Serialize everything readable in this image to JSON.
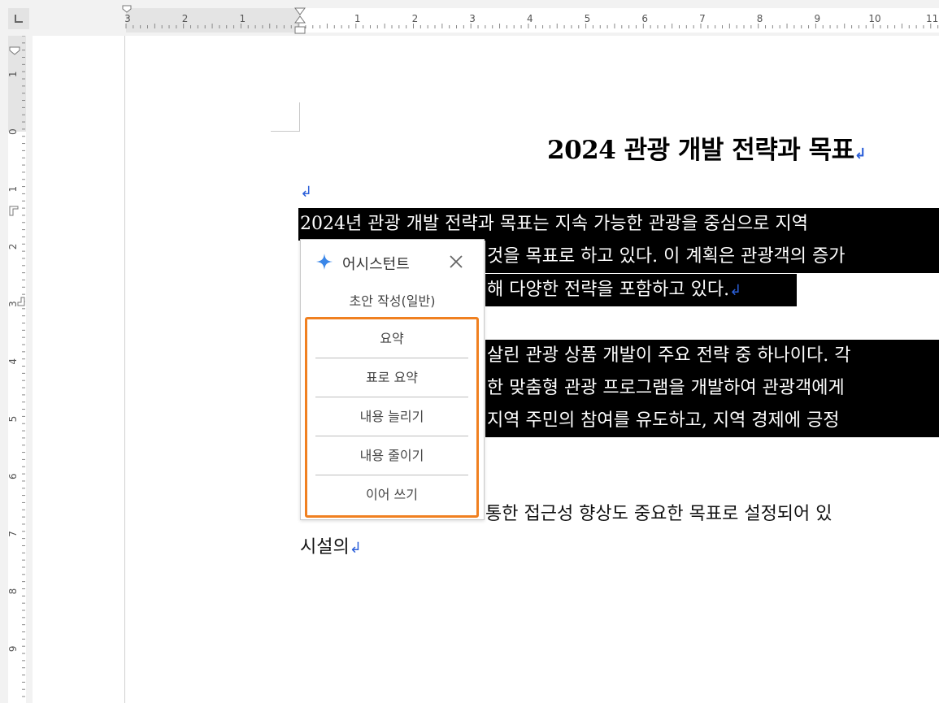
{
  "ruler": {
    "horizontal_left": [
      "3",
      "2",
      "1"
    ],
    "horizontal_right": [
      "1",
      "2",
      "3",
      "4",
      "5",
      "6",
      "7",
      "8",
      "9",
      "10",
      "11"
    ],
    "vertical": [
      "1",
      "0",
      "1",
      "2",
      "3",
      "4",
      "5",
      "6",
      "7",
      "8",
      "9"
    ]
  },
  "document": {
    "title": "2024 관광 개발 전략과 목표",
    "lines": [
      "2024년 관광 개발 전략과 목표는 지속 가능한 관광을 중심으로 지역",
      " 것을 목표로 하고 있다. 이 계획은 관광객의 증가",
      "해 다양한 전략을 포함하고 있다.",
      "살린 관광 상품 개발이 주요 전략 중 하나이다. 각",
      "한 맞춤형 관광 프로그램을 개발하여 관광객에게",
      " 지역 주민의 참여를 유도하고, 지역 경제에 긍정",
      " 통한 접근성 향상도 중요한 목표로 설정되어 있",
      "시설의"
    ]
  },
  "assistant": {
    "title": "어시스턴트",
    "mode": "초안 작성(일반)",
    "menu": [
      "요약",
      "표로 요약",
      "내용 늘리기",
      "내용 줄이기",
      "이어 쓰기"
    ],
    "accent": "#f08020",
    "sparkle_color": "#3a86e8"
  }
}
